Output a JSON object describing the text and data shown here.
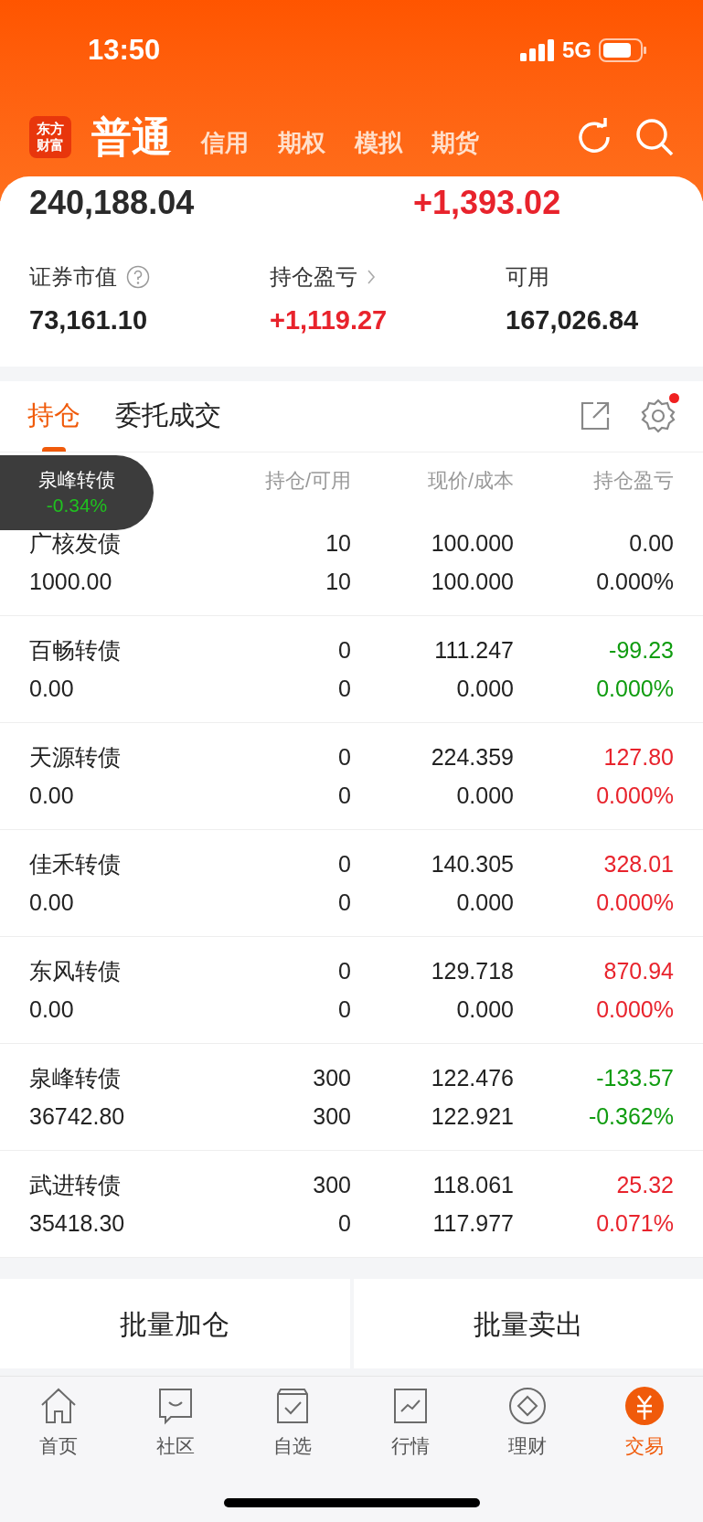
{
  "status_bar": {
    "time": "13:50",
    "network": "5G"
  },
  "header": {
    "logo": "东方财富",
    "tabs": [
      {
        "label": "普通",
        "selected": true
      },
      {
        "label": "信用",
        "selected": false
      },
      {
        "label": "期权",
        "selected": false
      },
      {
        "label": "模拟",
        "selected": false
      },
      {
        "label": "期货",
        "selected": false
      }
    ]
  },
  "summary": {
    "total_assets": "240,188.04",
    "today_pnl": {
      "value": "+1,393.02",
      "color": "#e8232c"
    },
    "stats": [
      {
        "label": "证券市值",
        "value": "73,161.10",
        "color": "#222222",
        "kind": "help"
      },
      {
        "label": "持仓盈亏",
        "value": "+1,119.27",
        "color": "#e8232c",
        "kind": "link"
      },
      {
        "label": "可用",
        "value": "167,026.84",
        "color": "#222222",
        "kind": "plain"
      }
    ]
  },
  "section_tabs": [
    {
      "label": "持仓",
      "selected": true
    },
    {
      "label": "委托成交",
      "selected": false
    }
  ],
  "settings_badge": true,
  "toast": {
    "name": "泉峰转债",
    "change": "-0.34%",
    "color": "#1fc21f"
  },
  "columns": [
    "持仓/可用",
    "现价/成本",
    "持仓盈亏"
  ],
  "rows": [
    {
      "name": "广核发债",
      "market_value": "1000.00",
      "holding": "10",
      "available": "10",
      "price": "100.000",
      "cost": "100.000",
      "pnl": "0.00",
      "pnl_pct": "0.000%",
      "color": "#222222"
    },
    {
      "name": "百畅转债",
      "market_value": "0.00",
      "holding": "0",
      "available": "0",
      "price": "111.247",
      "cost": "0.000",
      "pnl": "-99.23",
      "pnl_pct": "0.000%",
      "color": "#109c10"
    },
    {
      "name": "天源转债",
      "market_value": "0.00",
      "holding": "0",
      "available": "0",
      "price": "224.359",
      "cost": "0.000",
      "pnl": "127.80",
      "pnl_pct": "0.000%",
      "color": "#e8232c"
    },
    {
      "name": "佳禾转债",
      "market_value": "0.00",
      "holding": "0",
      "available": "0",
      "price": "140.305",
      "cost": "0.000",
      "pnl": "328.01",
      "pnl_pct": "0.000%",
      "color": "#e8232c"
    },
    {
      "name": "东风转债",
      "market_value": "0.00",
      "holding": "0",
      "available": "0",
      "price": "129.718",
      "cost": "0.000",
      "pnl": "870.94",
      "pnl_pct": "0.000%",
      "color": "#e8232c"
    },
    {
      "name": "泉峰转债",
      "market_value": "36742.80",
      "holding": "300",
      "available": "300",
      "price": "122.476",
      "cost": "122.921",
      "pnl": "-133.57",
      "pnl_pct": "-0.362%",
      "color": "#109c10"
    },
    {
      "name": "武进转债",
      "market_value": "35418.30",
      "holding": "300",
      "available": "0",
      "price": "118.061",
      "cost": "117.977",
      "pnl": "25.32",
      "pnl_pct": "0.071%",
      "color": "#e8232c"
    }
  ],
  "actions": [
    "批量加仓",
    "批量卖出"
  ],
  "bottom_nav": [
    {
      "label": "首页",
      "kind": "home",
      "selected": false
    },
    {
      "label": "社区",
      "kind": "chat",
      "selected": false
    },
    {
      "label": "自选",
      "kind": "check",
      "selected": false
    },
    {
      "label": "行情",
      "kind": "chart",
      "selected": false
    },
    {
      "label": "理财",
      "kind": "diamond",
      "selected": false
    },
    {
      "label": "交易",
      "kind": "yuan",
      "selected": true
    }
  ]
}
